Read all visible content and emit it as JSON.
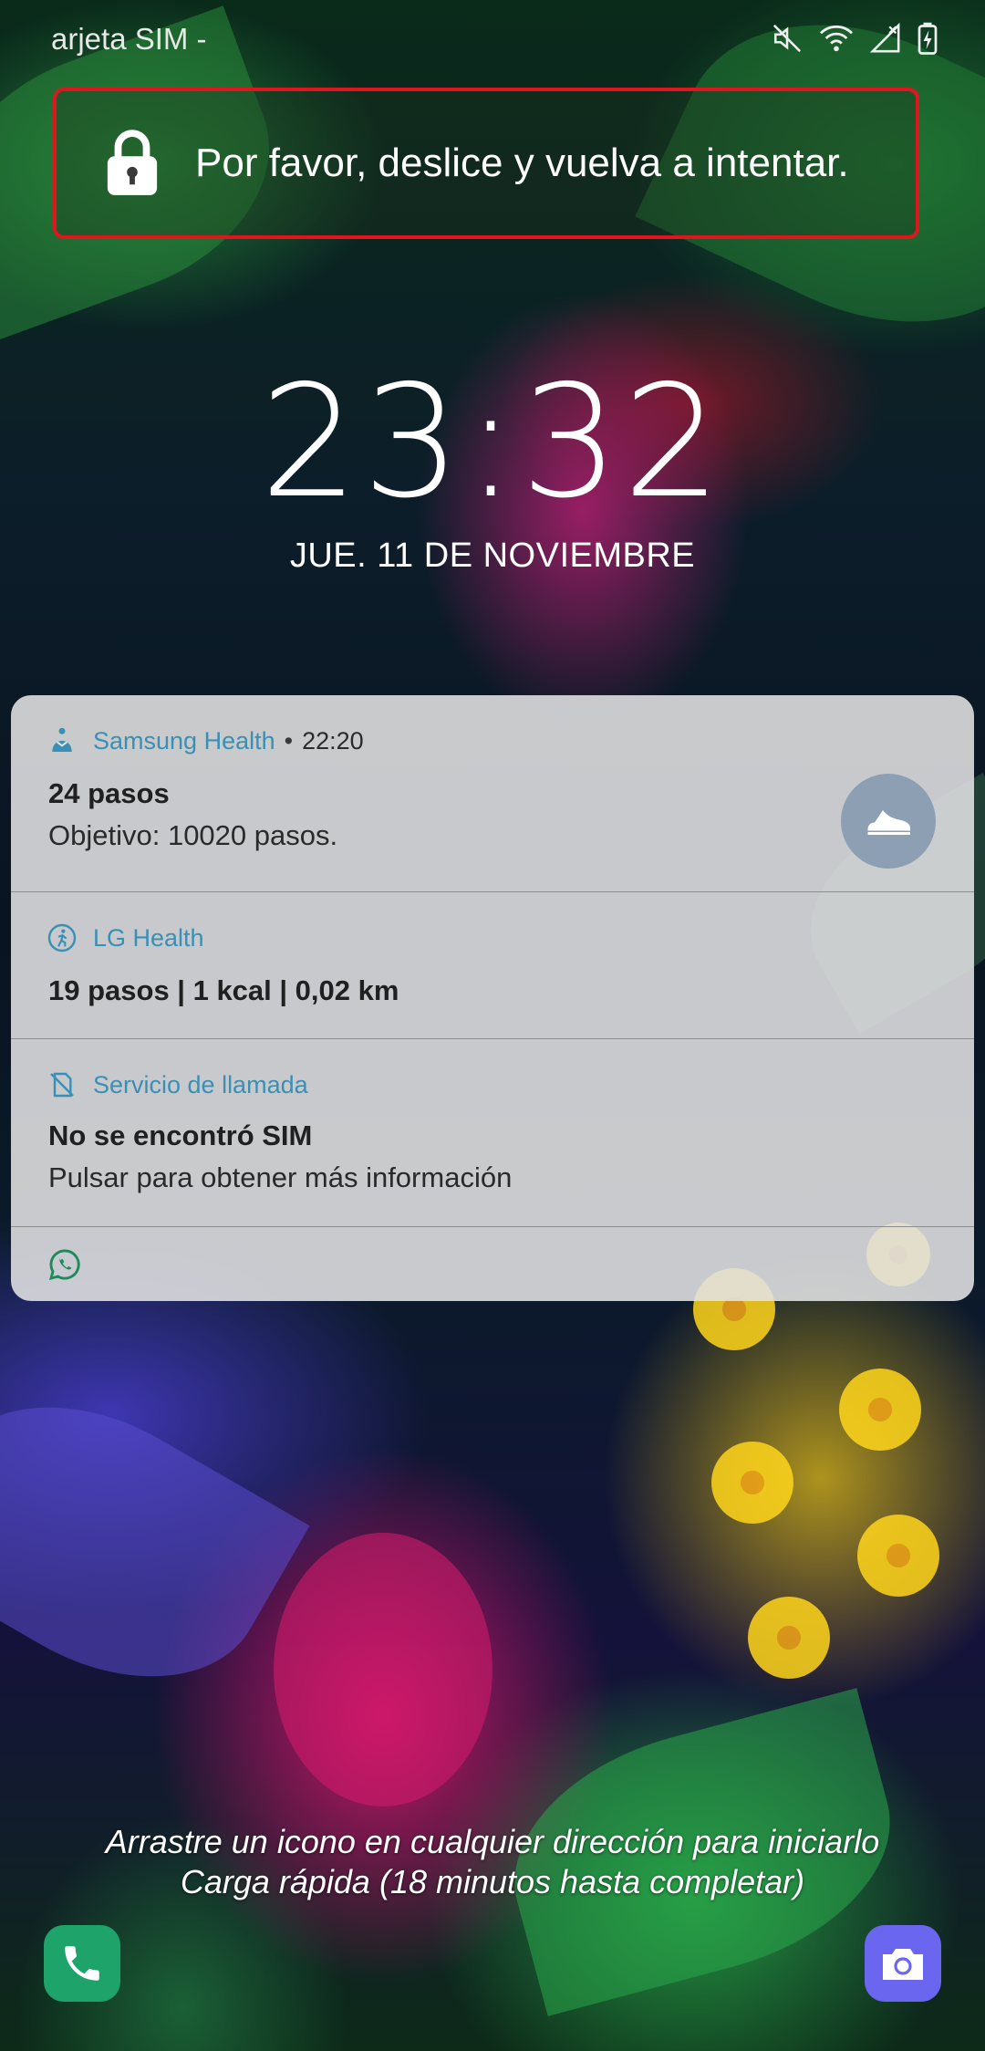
{
  "status_bar": {
    "carrier": "arjeta SIM -",
    "icons": [
      "mute-icon",
      "wifi-icon",
      "no-signal-icon",
      "battery-charging-icon"
    ]
  },
  "unlock_banner": {
    "icon": "lock-icon",
    "message": "Por favor, deslice y vuelva a intentar.",
    "border_color": "#e0161e"
  },
  "lockscreen": {
    "time_hours": "23",
    "time_sep": ":",
    "time_minutes": "32",
    "date": "JUE. 11 DE NOVIEMBRE"
  },
  "notifications": [
    {
      "app_icon": "samsung-health-icon",
      "app_name": "Samsung Health",
      "time": "22:20",
      "title": "24 pasos",
      "body": "Objetivo: 10020 pasos.",
      "action_icon": "shoe-icon"
    },
    {
      "app_icon": "lg-health-icon",
      "app_name": "LG Health",
      "title": "19 pasos | 1 kcal | 0,02 km"
    },
    {
      "app_icon": "no-sim-icon",
      "app_name": "Servicio de llamada",
      "title": "No se encontró SIM",
      "body": "Pulsar para obtener más información"
    },
    {
      "app_icon": "whatsapp-icon"
    }
  ],
  "hints": {
    "line1": "Arrastre un icono en cualquier dirección para iniciarlo",
    "line2": "Carga rápida (18 minutos hasta completar)"
  },
  "shortcuts": {
    "left": "phone-icon",
    "right": "camera-icon"
  },
  "colors": {
    "app_accent": "#3a8fb4",
    "phone": "#1ea46a",
    "camera": "#6a66f0"
  }
}
